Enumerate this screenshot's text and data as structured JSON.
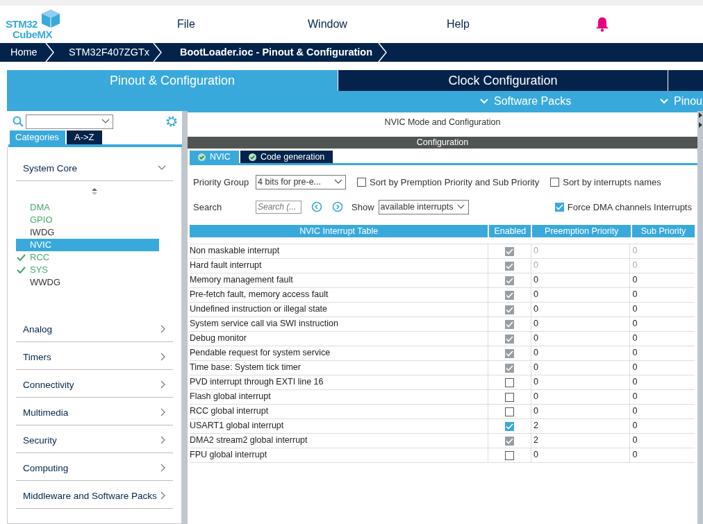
{
  "logo": [
    "STM32",
    "CubeMX"
  ],
  "menu": [
    "File",
    "Window",
    "Help"
  ],
  "breadcrumb": [
    {
      "label": "Home",
      "current": false
    },
    {
      "label": "STM32F407ZGTx",
      "current": false
    },
    {
      "label": "BootLoader.ioc - Pinout & Configuration",
      "current": true
    }
  ],
  "main_tabs": [
    {
      "label": "Pinout & Configuration",
      "selected": true
    },
    {
      "label": "Clock Configuration",
      "selected": false
    }
  ],
  "sub_menu": [
    "Software Packs",
    "Pinou"
  ],
  "sidebar": {
    "view_tabs": [
      {
        "label": "Categories",
        "selected": true
      },
      {
        "label": "A->Z",
        "selected": false
      }
    ],
    "categories": [
      {
        "label": "System Core",
        "expanded": true,
        "items": [
          {
            "label": "DMA",
            "configured": true,
            "checked": false,
            "selected": false
          },
          {
            "label": "GPIO",
            "configured": true,
            "checked": false,
            "selected": false
          },
          {
            "label": "IWDG",
            "configured": false,
            "checked": false,
            "selected": false
          },
          {
            "label": "NVIC",
            "configured": false,
            "checked": false,
            "selected": true
          },
          {
            "label": "RCC",
            "configured": true,
            "checked": true,
            "selected": false
          },
          {
            "label": "SYS",
            "configured": true,
            "checked": true,
            "selected": false
          },
          {
            "label": "WWDG",
            "configured": false,
            "checked": false,
            "selected": false
          }
        ]
      },
      {
        "label": "Analog",
        "expanded": false
      },
      {
        "label": "Timers",
        "expanded": false
      },
      {
        "label": "Connectivity",
        "expanded": false
      },
      {
        "label": "Multimedia",
        "expanded": false
      },
      {
        "label": "Security",
        "expanded": false
      },
      {
        "label": "Computing",
        "expanded": false
      },
      {
        "label": "Middleware and Software Packs",
        "expanded": false
      }
    ]
  },
  "panel": {
    "title": "NVIC Mode and Configuration",
    "section": "Configuration",
    "tabs": [
      {
        "label": "NVIC",
        "selected": true
      },
      {
        "label": "Code generation",
        "selected": false
      }
    ],
    "priority_group": {
      "label": "Priority Group",
      "value": "4 bits for pre-e..."
    },
    "sort_options": [
      {
        "label": "Sort by Premption Priority and Sub Priority",
        "checked": false
      },
      {
        "label": "Sort by interrupts names",
        "checked": false
      }
    ],
    "search": {
      "label": "Search",
      "placeholder": "Search (..."
    },
    "show": {
      "label": "Show",
      "value": "available interrupts"
    },
    "force_dma": {
      "label": "Force DMA channels Interrupts",
      "checked": true
    },
    "table": {
      "columns": [
        "NVIC Interrupt Table",
        "Enabled",
        "Preemption Priority",
        "Sub Priority"
      ],
      "rows": [
        {
          "name": "Non maskable interrupt",
          "enabled": true,
          "disabled": true,
          "preemption": "0",
          "sub": "0",
          "priority_disabled": true
        },
        {
          "name": "Hard fault interrupt",
          "enabled": true,
          "disabled": true,
          "preemption": "0",
          "sub": "0",
          "priority_disabled": true
        },
        {
          "name": "Memory management fault",
          "enabled": true,
          "disabled": true,
          "preemption": "0",
          "sub": "0",
          "priority_disabled": false
        },
        {
          "name": "Pre-fetch fault, memory access fault",
          "enabled": true,
          "disabled": true,
          "preemption": "0",
          "sub": "0",
          "priority_disabled": false
        },
        {
          "name": "Undefined instruction or illegal state",
          "enabled": true,
          "disabled": true,
          "preemption": "0",
          "sub": "0",
          "priority_disabled": false
        },
        {
          "name": "System service call via SWI instruction",
          "enabled": true,
          "disabled": true,
          "preemption": "0",
          "sub": "0",
          "priority_disabled": false
        },
        {
          "name": "Debug monitor",
          "enabled": true,
          "disabled": true,
          "preemption": "0",
          "sub": "0",
          "priority_disabled": false
        },
        {
          "name": "Pendable request for system service",
          "enabled": true,
          "disabled": true,
          "preemption": "0",
          "sub": "0",
          "priority_disabled": false
        },
        {
          "name": "Time base: System tick timer",
          "enabled": true,
          "disabled": true,
          "preemption": "0",
          "sub": "0",
          "priority_disabled": false
        },
        {
          "name": "PVD interrupt through EXTI line 16",
          "enabled": false,
          "disabled": false,
          "preemption": "0",
          "sub": "0",
          "priority_disabled": false
        },
        {
          "name": "Flash global interrupt",
          "enabled": false,
          "disabled": false,
          "preemption": "0",
          "sub": "0",
          "priority_disabled": false
        },
        {
          "name": "RCC global interrupt",
          "enabled": false,
          "disabled": false,
          "preemption": "0",
          "sub": "0",
          "priority_disabled": false
        },
        {
          "name": "USART1 global interrupt",
          "enabled": true,
          "disabled": false,
          "preemption": "2",
          "sub": "0",
          "priority_disabled": false
        },
        {
          "name": "DMA2 stream2 global interrupt",
          "enabled": true,
          "disabled": true,
          "preemption": "2",
          "sub": "0",
          "priority_disabled": false
        },
        {
          "name": "FPU global interrupt",
          "enabled": false,
          "disabled": false,
          "preemption": "0",
          "sub": "0",
          "priority_disabled": false
        }
      ]
    }
  }
}
